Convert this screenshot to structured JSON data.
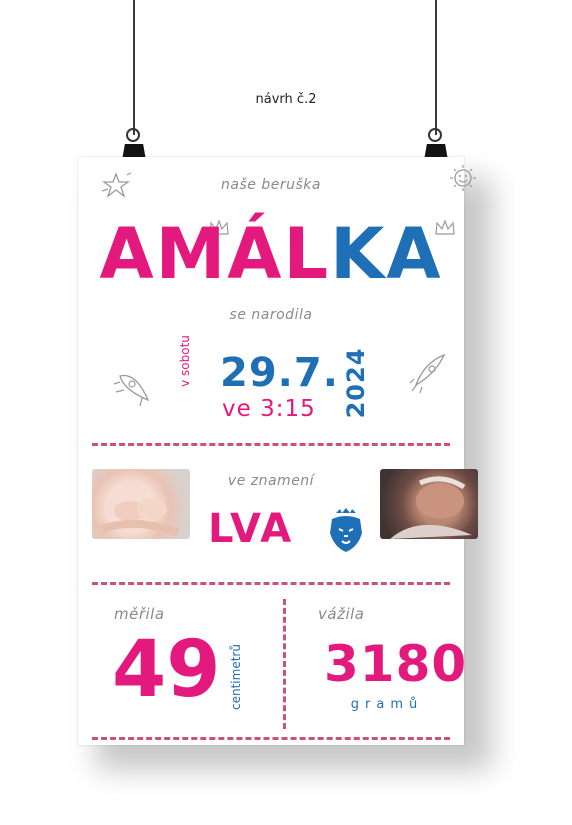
{
  "caption": "návrh č.2",
  "poster": {
    "intro": "naše beruška",
    "name_part1": "AMÁL",
    "name_part2": "KA",
    "born": "se narodila",
    "day_label": "v sobotu",
    "date": "29.7.",
    "time": "ve 3:15",
    "year": "2024",
    "zodiac_intro": "ve znamení",
    "zodiac": "LVA",
    "length_label": "měřila",
    "length_value": "49",
    "length_unit": "centimetrů",
    "weight_label": "vážila",
    "weight_value": "3180",
    "weight_unit": "gramů"
  },
  "colors": {
    "pink": "#e4197d",
    "blue": "#1f6fb6",
    "dash": "#c8527d"
  },
  "icons": [
    "star-icon",
    "crown-icon",
    "sun-icon",
    "rocket-icon",
    "lion-icon"
  ]
}
